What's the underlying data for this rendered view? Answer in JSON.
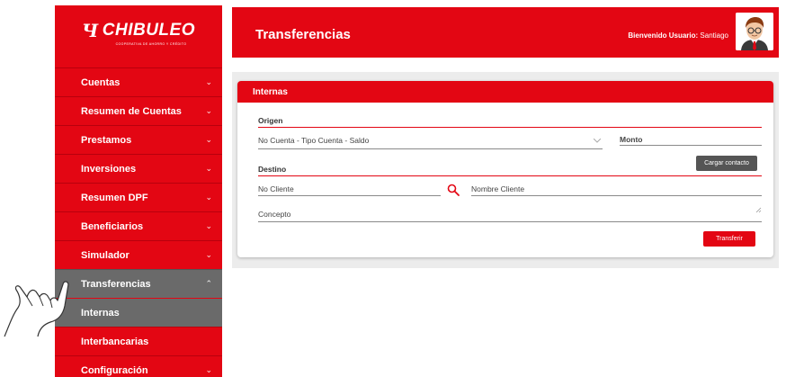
{
  "sidebar": {
    "logo_text": "CHIBULEO",
    "logo_mark": "Ч",
    "logo_tagline": "COOPERATIVA DE AHORRO Y CRÉDITO",
    "items": [
      {
        "label": "Cuentas",
        "chevron": "⌄"
      },
      {
        "label": "Resumen de Cuentas",
        "chevron": "⌄"
      },
      {
        "label": "Prestamos",
        "chevron": "⌄"
      },
      {
        "label": "Inversiones",
        "chevron": "⌄"
      },
      {
        "label": "Resumen DPF",
        "chevron": "⌄"
      },
      {
        "label": "Beneficiarios",
        "chevron": "⌄"
      },
      {
        "label": "Simulador",
        "chevron": "⌄"
      },
      {
        "label": "Transferencias",
        "chevron": "⌃"
      },
      {
        "label": "Interbancarias",
        "chevron": ""
      },
      {
        "label": "Configuración",
        "chevron": "⌄"
      }
    ],
    "sub_item": "Internas"
  },
  "header": {
    "title": "Transferencias",
    "welcome_label": "Bienvenido Usuario:",
    "welcome_user": "Santiago"
  },
  "card": {
    "title": "Internas",
    "origen_label": "Origen",
    "origen_select": "No Cuenta - Tipo Cuenta - Saldo",
    "monto_label": "Monto",
    "cargar_button": "Cargar contacto",
    "destino_label": "Destino",
    "no_cliente_placeholder": "No Cliente",
    "nombre_cliente_placeholder": "Nombre Cliente",
    "concepto_placeholder": "Concepto",
    "transferir_button": "Transferir"
  },
  "colors": {
    "brand_red": "#e30613",
    "active_gray": "#6a6a6a",
    "button_dark": "#555555"
  },
  "icons": [
    "search-icon",
    "chevron-down-icon",
    "chevron-up-icon",
    "avatar-icon",
    "hand-pointer-icon",
    "resize-grip-icon"
  ]
}
